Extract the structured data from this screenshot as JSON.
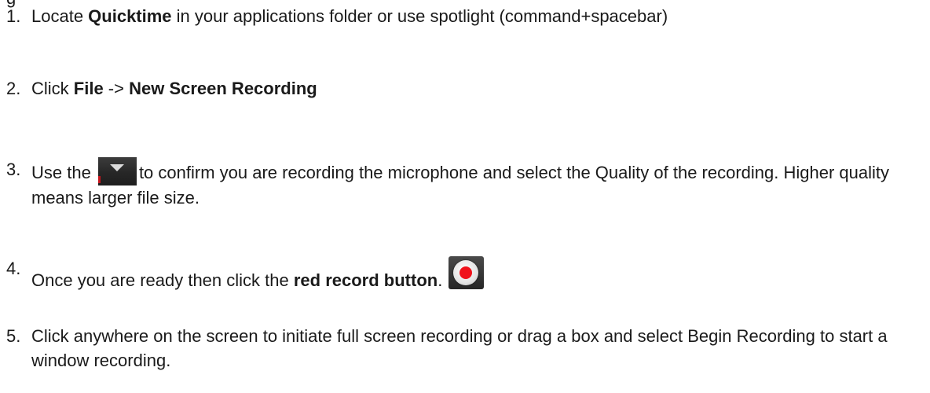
{
  "top_fragment": "g",
  "steps": [
    {
      "num": "1.",
      "a": "Locate ",
      "b": "Quicktime",
      "c": " in your applications folder or use spotlight (command+spacebar)"
    },
    {
      "num": "2.",
      "a": "Click ",
      "b": "File",
      "c": " -> ",
      "d": "New Screen Recording"
    },
    {
      "num": "3.",
      "a": "Use the ",
      "icon": "dropdown-chevron-icon",
      "c": "to confirm you are recording the microphone and select the Quality of the recording. Higher quality means larger file size."
    },
    {
      "num": "4.",
      "a": "Once you are ready then click the ",
      "b": "red record button",
      "c": ".",
      "icon": "record-icon"
    },
    {
      "num": "5.",
      "a": "Click anywhere on the screen to initiate full screen recording or drag a box and select Begin Recording to start a window recording."
    }
  ],
  "colors": {
    "text": "#1a1a1a",
    "record_red": "#f0121b",
    "button_dark": "#272727"
  }
}
